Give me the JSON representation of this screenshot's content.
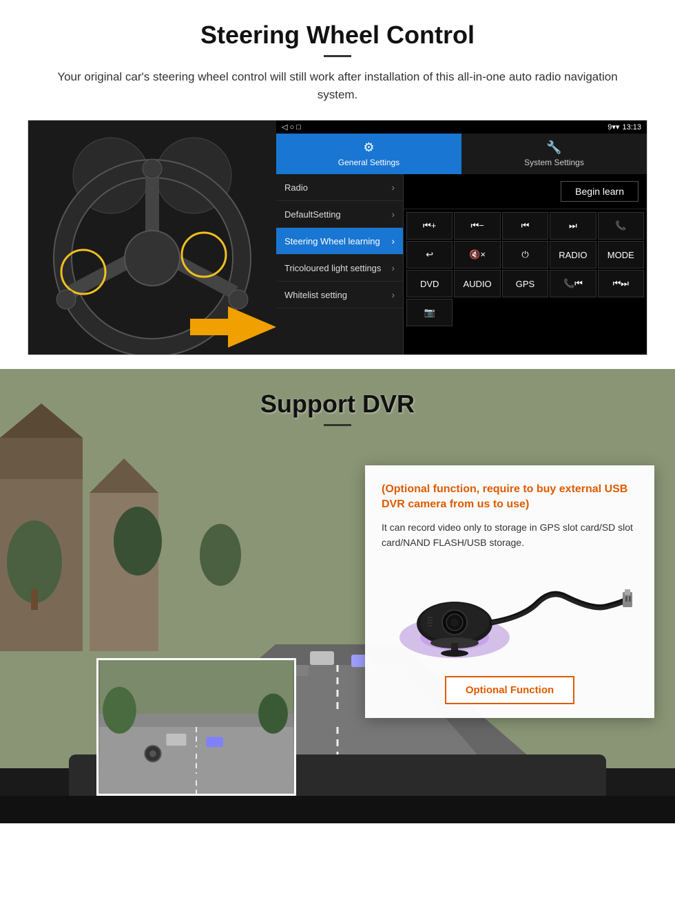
{
  "steering_section": {
    "title": "Steering Wheel Control",
    "subtitle": "Your original car's steering wheel control will still work after installation of this all-in-one auto radio navigation system.",
    "status_bar": {
      "signal": "▼",
      "wifi": "▾",
      "time": "13:13"
    },
    "tabs": [
      {
        "icon": "⚙",
        "label": "General Settings",
        "active": true
      },
      {
        "icon": "🔧",
        "label": "System Settings",
        "active": false
      }
    ],
    "menu_items": [
      {
        "label": "Radio",
        "active": false
      },
      {
        "label": "DefaultSetting",
        "active": false
      },
      {
        "label": "Steering Wheel learning",
        "active": true
      },
      {
        "label": "Tricoloured light settings",
        "active": false
      },
      {
        "label": "Whitelist setting",
        "active": false
      }
    ],
    "begin_learn_label": "Begin learn",
    "control_buttons": [
      "⏮+",
      "⏮−",
      "⏮⏮",
      "⏭⏭",
      "📞",
      "↩",
      "🔇×",
      "⏻",
      "RADIO",
      "MODE",
      "DVD",
      "AUDIO",
      "GPS",
      "📞⏮",
      "⏮⏭",
      "📷"
    ]
  },
  "dvr_section": {
    "title": "Support DVR",
    "card": {
      "title": "(Optional function, require to buy external USB DVR camera from us to use)",
      "description": "It can record video only to storage in GPS slot card/SD slot card/NAND FLASH/USB storage.",
      "optional_button_label": "Optional Function"
    }
  }
}
